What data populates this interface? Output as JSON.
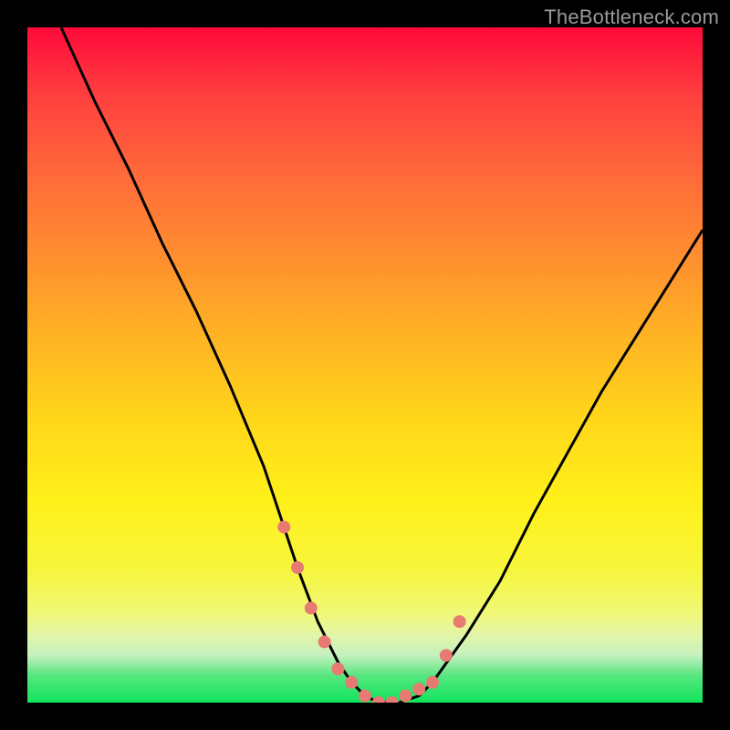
{
  "attribution": "TheBottleneck.com",
  "colors": {
    "frame": "#000000",
    "curve_stroke": "#000000",
    "marker_fill": "#e87a74",
    "gradient_top": "#ff0a3a",
    "gradient_bottom": "#10e45c"
  },
  "chart_data": {
    "type": "line",
    "title": "",
    "xlabel": "",
    "ylabel": "",
    "xlim": [
      0,
      100
    ],
    "ylim": [
      0,
      100
    ],
    "series": [
      {
        "name": "bottleneck-curve",
        "x": [
          5,
          10,
          15,
          20,
          25,
          30,
          35,
          38,
          40,
          43,
          46,
          48,
          50,
          52,
          55,
          58,
          60,
          65,
          70,
          75,
          80,
          85,
          90,
          95,
          100
        ],
        "y": [
          100,
          89,
          79,
          68,
          58,
          47,
          35,
          26,
          20,
          12,
          6,
          3,
          1,
          0,
          0,
          1,
          3,
          10,
          18,
          28,
          37,
          46,
          54,
          62,
          70
        ]
      }
    ],
    "markers": {
      "name": "highlight-points",
      "x": [
        38,
        40,
        42,
        44,
        46,
        48,
        50,
        52,
        54,
        56,
        58,
        60,
        62,
        64
      ],
      "y": [
        26,
        20,
        14,
        9,
        5,
        3,
        1,
        0,
        0,
        1,
        2,
        3,
        7,
        12
      ]
    },
    "grid": false,
    "legend": false
  }
}
